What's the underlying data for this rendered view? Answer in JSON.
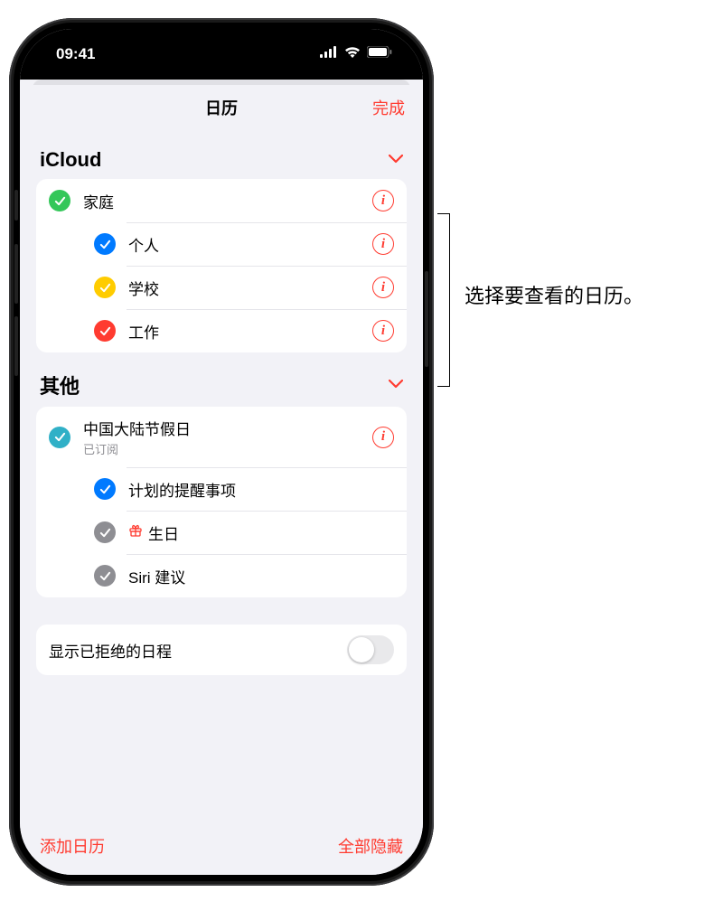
{
  "status": {
    "time": "09:41"
  },
  "nav": {
    "title": "日历",
    "done": "完成"
  },
  "sections": {
    "icloud": {
      "title": "iCloud",
      "items": [
        {
          "label": "家庭",
          "color": "#34c759",
          "info": true
        },
        {
          "label": "个人",
          "color": "#007aff",
          "info": true
        },
        {
          "label": "学校",
          "color": "#ffcc00",
          "info": true
        },
        {
          "label": "工作",
          "color": "#ff3b30",
          "info": true
        }
      ]
    },
    "other": {
      "title": "其他",
      "items": [
        {
          "label": "中国大陆节假日",
          "sub": "已订阅",
          "color": "#30b0c7",
          "info": true
        },
        {
          "label": "计划的提醒事项",
          "color": "#007aff",
          "info": false
        },
        {
          "label": "生日",
          "color": "#8e8e93",
          "info": false,
          "gift": true
        },
        {
          "label": "Siri 建议",
          "color": "#8e8e93",
          "info": false
        }
      ]
    }
  },
  "setting": {
    "declined_label": "显示已拒绝的日程",
    "value": false
  },
  "toolbar": {
    "add": "添加日历",
    "hide_all": "全部隐藏"
  },
  "annotation": "选择要查看的日历。"
}
